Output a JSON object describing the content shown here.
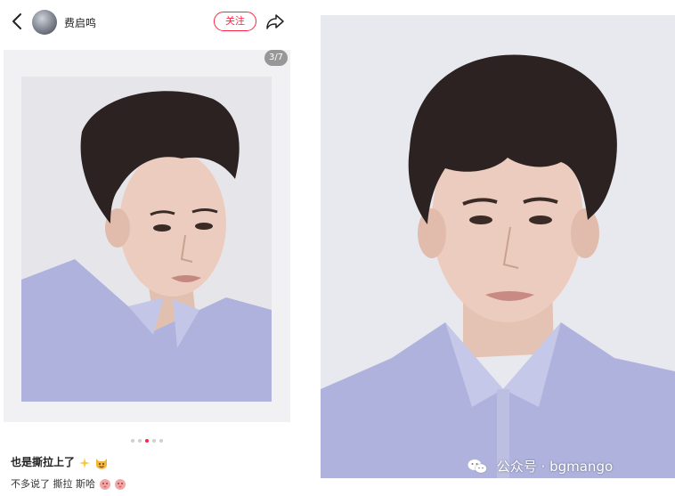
{
  "header": {
    "author_name": "费启鸣",
    "follow_label": "关注"
  },
  "gallery": {
    "counter": "3/7",
    "dots_total": 5,
    "dots_active_index": 2
  },
  "caption": {
    "title": "也是撕拉上了",
    "body": "不多说了 撕拉 斯哈"
  },
  "watermark": {
    "text": "公众号 · bgmango"
  },
  "colors": {
    "accent": "#ff2442",
    "shirt": "#aeb2dd",
    "hair": "#2b2221",
    "skin": "#e9c9ba",
    "background": "#e9eaee"
  }
}
